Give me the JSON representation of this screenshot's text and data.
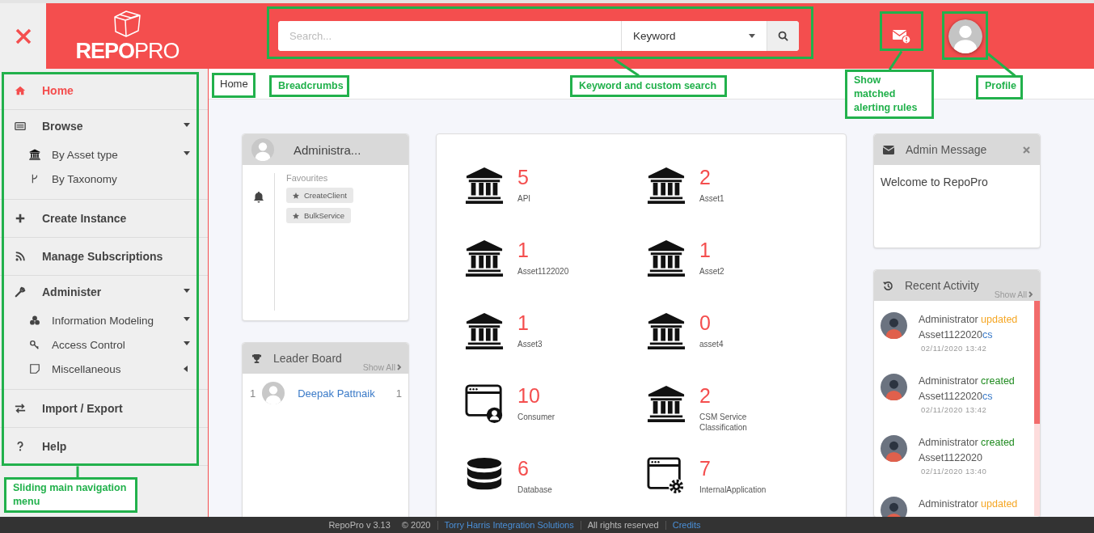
{
  "header": {
    "logo": {
      "bold": "REPO",
      "light": "PRO"
    },
    "search": {
      "placeholder": "Search...",
      "scope": "Keyword"
    }
  },
  "breadcrumbs": [
    {
      "label": "Home"
    }
  ],
  "sidebar": {
    "items": [
      {
        "label": "Home",
        "selected": true
      },
      {
        "label": "Browse",
        "selected": false,
        "expanded": true,
        "children": [
          {
            "label": "By Asset type",
            "selected": false,
            "expanded": true
          },
          {
            "label": "By Taxonomy",
            "selected": false
          }
        ]
      },
      {
        "label": "Create Instance",
        "selected": false
      },
      {
        "label": "Manage Subscriptions",
        "selected": false
      },
      {
        "label": "Administer",
        "selected": false,
        "expanded": true,
        "children": [
          {
            "label": "Information Modeling",
            "selected": false,
            "expanded": true
          },
          {
            "label": "Access Control",
            "selected": false,
            "expanded": true
          },
          {
            "label": "Miscellaneous",
            "selected": false,
            "expanded": false
          }
        ]
      },
      {
        "label": "Import / Export",
        "selected": false
      },
      {
        "label": "Help",
        "selected": false
      }
    ]
  },
  "profile_card": {
    "name": "Administra...",
    "favourites_title": "Favourites",
    "favourites": [
      "CreateClient",
      "BulkService"
    ]
  },
  "leader_board": {
    "title": "Leader Board",
    "show_all": "Show All",
    "rows": [
      {
        "rank": "1",
        "name": "Deepak Pattnaik",
        "score": "1"
      }
    ]
  },
  "asset_tiles": [
    {
      "count": "5",
      "label": "API"
    },
    {
      "count": "2",
      "label": "Asset1"
    },
    {
      "count": "1",
      "label": "Asset1122020"
    },
    {
      "count": "1",
      "label": "Asset2"
    },
    {
      "count": "1",
      "label": "Asset3"
    },
    {
      "count": "0",
      "label": "asset4"
    },
    {
      "count": "10",
      "label": "Consumer"
    },
    {
      "count": "2",
      "label": "CSM Service Classification"
    },
    {
      "count": "6",
      "label": "Database"
    },
    {
      "count": "7",
      "label": "InternalApplication"
    }
  ],
  "admin_message": {
    "title": "Admin Message",
    "body": "Welcome to RepoPro"
  },
  "recent_activity": {
    "title": "Recent Activity",
    "show_all": "Show All",
    "items": [
      {
        "user": "Administrator",
        "action": "updated",
        "color": "#f5a623",
        "asset": "Asset1122020",
        "link": "cs",
        "time": "02/11/2020 13:42"
      },
      {
        "user": "Administrator",
        "action": "created",
        "color": "#1e8a1e",
        "asset": "Asset1122020",
        "link": "cs",
        "time": "02/11/2020 13:42"
      },
      {
        "user": "Administrator",
        "action": "created",
        "color": "#1e8a1e",
        "asset": "Asset1122020",
        "time": "02/11/2020 13:40"
      },
      {
        "user": "Administrator",
        "action": "updated",
        "color": "#f5a623"
      }
    ]
  },
  "footer": {
    "version": "RepoPro v 3.13",
    "copyright": "© 2020",
    "company": "Torry Harris Integration Solutions",
    "rights": "All rights reserved",
    "credits": "Credits"
  },
  "annotations": [
    {
      "label": "Breadcrumbs"
    },
    {
      "label": "Keyword and custom search"
    },
    {
      "label": "Show matched alerting rules"
    },
    {
      "label": "Profile"
    },
    {
      "label": "Sliding main navigation menu"
    }
  ]
}
